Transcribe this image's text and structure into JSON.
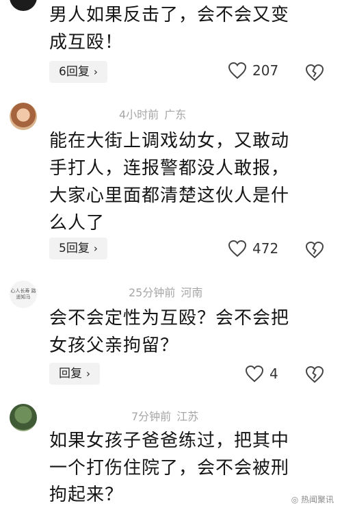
{
  "comments": [
    {
      "avatar": "dark-avatar",
      "time": "",
      "location": "",
      "lines": [
        "男人如果反击了，会不会又变",
        "成互殴！"
      ],
      "reply_label": "6回复",
      "likes": "207"
    },
    {
      "avatar": "baby-avatar",
      "time": "4小时前",
      "location": "广东",
      "lines": [
        "能在大街上调戏幼女，又敢动",
        "手打人，连报警都没人敢报，",
        "大家心里面都清楚这伙人是什",
        "么人了"
      ],
      "reply_label": "5回复",
      "likes": "472"
    },
    {
      "avatar": "calligraphy-avatar",
      "avatar_text": "心人长寿 路遥知马",
      "time": "25分钟前",
      "location": "河南",
      "lines": [
        "会不会定性为互殴？会不会把",
        "女孩父亲拘留？"
      ],
      "reply_label": "回复",
      "likes": "4"
    },
    {
      "avatar": "nature-avatar",
      "time": "7分钟前",
      "location": "江苏",
      "lines": [
        "如果女孩子爸爸练过，把其中",
        "一个打伤住院了，会不会被刑",
        "拘起来？"
      ],
      "reply_label": "",
      "likes": ""
    }
  ],
  "ui": {
    "chevron": "›",
    "watermark": "◎ 热闻聚讯"
  }
}
